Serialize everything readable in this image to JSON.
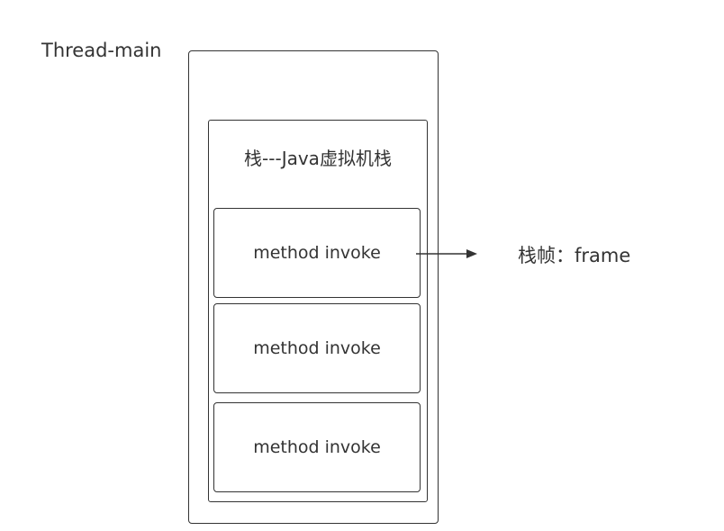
{
  "diagram": {
    "thread_label": "Thread-main",
    "stack_title": "栈---Java虚拟机栈",
    "frames": [
      "method invoke",
      "method invoke",
      "method invoke"
    ],
    "frame_annotation": "栈帧：frame",
    "colors": {
      "stroke": "#333333",
      "text": "#333333",
      "background": "#ffffff"
    }
  }
}
